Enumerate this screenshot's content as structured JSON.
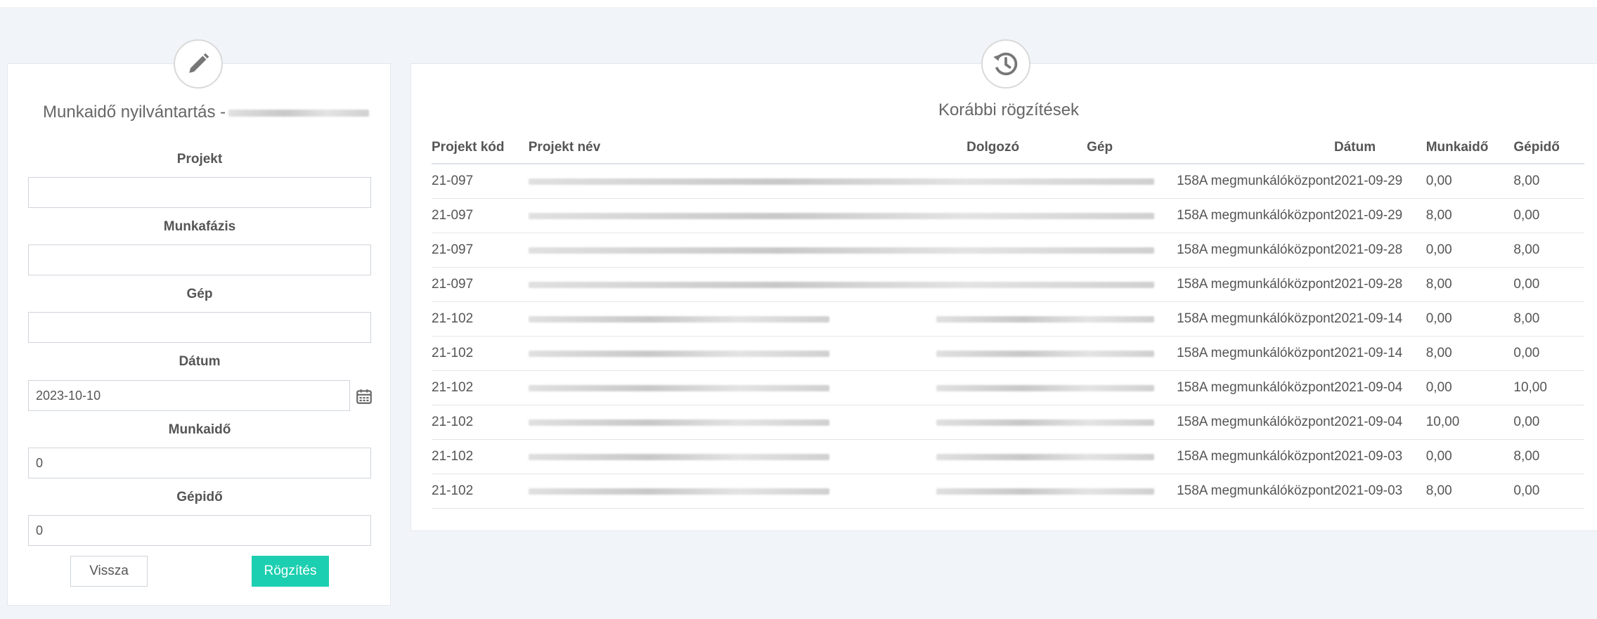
{
  "form": {
    "title": "Munkaidő nyilvántartás -",
    "fields": {
      "projekt": {
        "label": "Projekt",
        "value": ""
      },
      "munkafazis": {
        "label": "Munkafázis",
        "value": ""
      },
      "gep": {
        "label": "Gép",
        "value": ""
      },
      "datum": {
        "label": "Dátum",
        "value": "2023-10-10"
      },
      "munkaido": {
        "label": "Munkaidő",
        "value": "0"
      },
      "gepido": {
        "label": "Gépidő",
        "value": "0"
      }
    },
    "back_label": "Vissza",
    "save_label": "Rögzítés",
    "icon": "pencil-icon"
  },
  "history": {
    "title": "Korábbi rögzítések",
    "icon": "history-icon",
    "columns": [
      "Projekt kód",
      "Projekt név",
      "Dolgozó",
      "Gép",
      "Dátum",
      "Munkaidő",
      "Gépidő"
    ],
    "rows": [
      {
        "kod": "21-097",
        "gep": "158A megmunkálóközpont",
        "datum": "2021-09-29",
        "munkaido": "0,00",
        "gepido": "8,00"
      },
      {
        "kod": "21-097",
        "gep": "158A megmunkálóközpont",
        "datum": "2021-09-29",
        "munkaido": "8,00",
        "gepido": "0,00"
      },
      {
        "kod": "21-097",
        "gep": "158A megmunkálóközpont",
        "datum": "2021-09-28",
        "munkaido": "0,00",
        "gepido": "8,00"
      },
      {
        "kod": "21-097",
        "gep": "158A megmunkálóközpont",
        "datum": "2021-09-28",
        "munkaido": "8,00",
        "gepido": "0,00"
      },
      {
        "kod": "21-102",
        "gep": "158A megmunkálóközpont",
        "datum": "2021-09-14",
        "munkaido": "0,00",
        "gepido": "8,00"
      },
      {
        "kod": "21-102",
        "gep": "158A megmunkálóközpont",
        "datum": "2021-09-14",
        "munkaido": "8,00",
        "gepido": "0,00"
      },
      {
        "kod": "21-102",
        "gep": "158A megmunkálóközpont",
        "datum": "2021-09-04",
        "munkaido": "0,00",
        "gepido": "10,00"
      },
      {
        "kod": "21-102",
        "gep": "158A megmunkálóközpont",
        "datum": "2021-09-04",
        "munkaido": "10,00",
        "gepido": "0,00"
      },
      {
        "kod": "21-102",
        "gep": "158A megmunkálóközpont",
        "datum": "2021-09-03",
        "munkaido": "0,00",
        "gepido": "8,00"
      },
      {
        "kod": "21-102",
        "gep": "158A megmunkálóközpont",
        "datum": "2021-09-03",
        "munkaido": "8,00",
        "gepido": "0,00"
      }
    ]
  }
}
